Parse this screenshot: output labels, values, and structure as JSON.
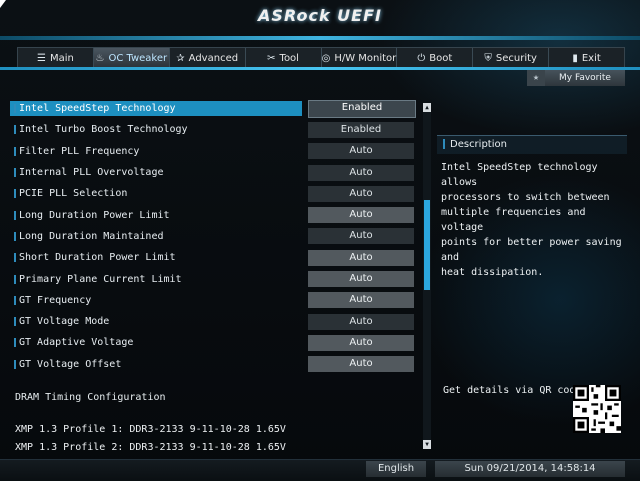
{
  "app": {
    "title": "ASRock UEFI"
  },
  "tabs": [
    {
      "label": "Main",
      "icon": "list-icon",
      "glyph": "☰"
    },
    {
      "label": "OC Tweaker",
      "icon": "flame-icon",
      "glyph": "♨"
    },
    {
      "label": "Advanced",
      "icon": "star-icon",
      "glyph": "✰"
    },
    {
      "label": "Tool",
      "icon": "wrench-icon",
      "glyph": "✂"
    },
    {
      "label": "H/W Monitor",
      "icon": "monitor-icon",
      "glyph": "◎"
    },
    {
      "label": "Boot",
      "icon": "power-icon",
      "glyph": "⏻"
    },
    {
      "label": "Security",
      "icon": "shield-icon",
      "glyph": "⛨"
    },
    {
      "label": "Exit",
      "icon": "exit-icon",
      "glyph": "▮"
    }
  ],
  "active_tab": "OC Tweaker",
  "favorite": {
    "label": "My Favorite",
    "icon": "star-icon",
    "glyph": "★"
  },
  "settings": [
    {
      "label": "Intel SpeedStep Technology",
      "value": "Enabled",
      "selected": true,
      "style": "dark"
    },
    {
      "label": "Intel Turbo Boost Technology",
      "value": "Enabled",
      "style": "dark"
    },
    {
      "label": "Filter PLL Frequency",
      "value": "Auto",
      "style": "dark"
    },
    {
      "label": "Internal PLL Overvoltage",
      "value": "Auto",
      "style": "dark"
    },
    {
      "label": "PCIE PLL Selection",
      "value": "Auto",
      "style": "dark"
    },
    {
      "label": "Long Duration Power Limit",
      "value": "Auto",
      "style": "light"
    },
    {
      "label": "Long Duration Maintained",
      "value": "Auto",
      "style": "dark"
    },
    {
      "label": "Short Duration Power Limit",
      "value": "Auto",
      "style": "light"
    },
    {
      "label": "Primary Plane Current Limit",
      "value": "Auto",
      "style": "light"
    },
    {
      "label": "GT Frequency",
      "value": "Auto",
      "style": "light"
    },
    {
      "label": "GT Voltage Mode",
      "value": "Auto",
      "style": "dark"
    },
    {
      "label": "GT Adaptive Voltage",
      "value": "Auto",
      "style": "light"
    },
    {
      "label": "GT Voltage Offset",
      "value": "Auto",
      "style": "light"
    }
  ],
  "section": {
    "title": "DRAM Timing Configuration"
  },
  "xmp_profiles": [
    "XMP 1.3 Profile 1: DDR3-2133 9-11-10-28 1.65V",
    "XMP 1.3 Profile 2: DDR3-2133 9-11-10-28 1.65V"
  ],
  "description": {
    "heading": "Description",
    "text": "Intel SpeedStep technology allows\nprocessors to switch between\nmultiple frequencies and voltage\npoints for better power saving and\nheat dissipation."
  },
  "qr": {
    "label": "Get details via QR code"
  },
  "footer": {
    "language": "English",
    "datetime": "Sun 09/21/2014, 14:58:14"
  },
  "colors": {
    "accent": "#1d8fc0",
    "scroll_thumb": "#2ba6de"
  }
}
